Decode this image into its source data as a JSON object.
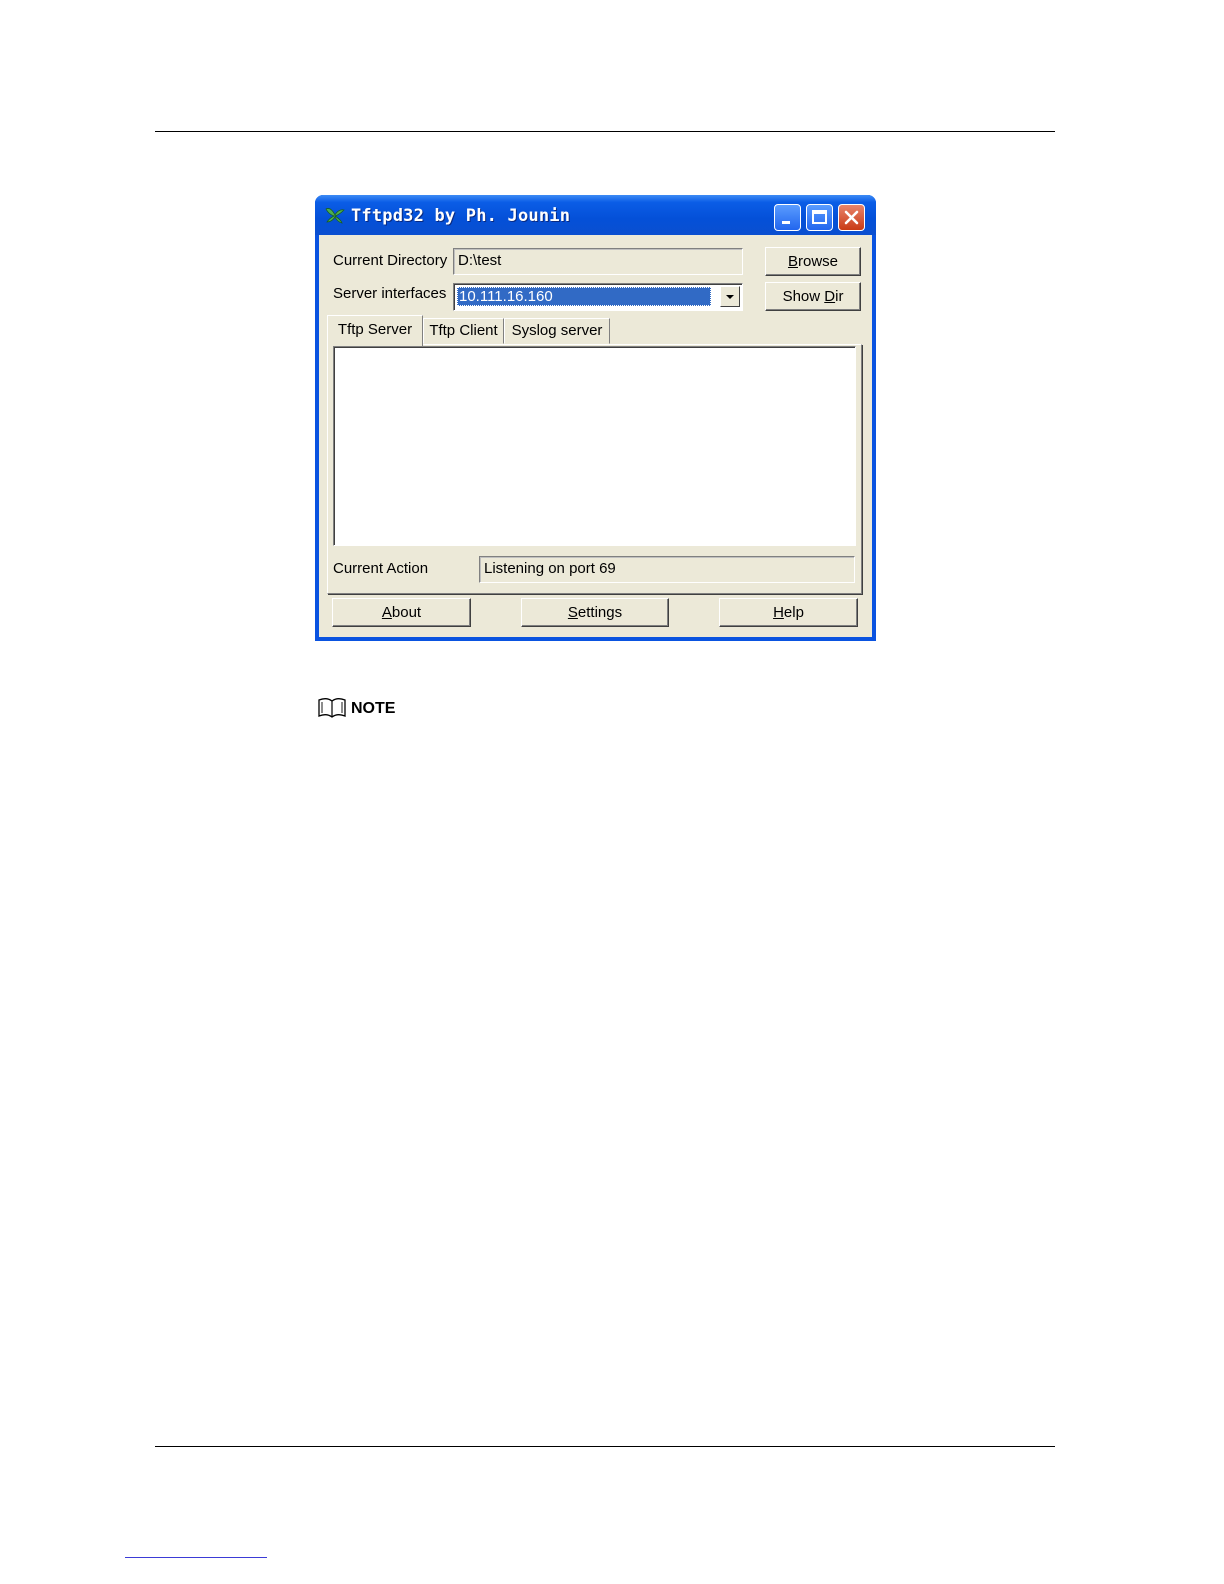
{
  "window": {
    "title": "Tftpd32 by Ph. Jounin",
    "current_directory_label": "Current Directory",
    "current_directory_value": "D:\\test",
    "server_interfaces_label": "Server interfaces",
    "server_interfaces_value": "10.111.16.160",
    "browse_pre": "",
    "browse_key": "B",
    "browse_post": "rowse",
    "showdir_pre": "Show ",
    "showdir_key": "D",
    "showdir_post": "ir",
    "tabs": [
      {
        "label": "Tftp Server"
      },
      {
        "label": "Tftp Client"
      },
      {
        "label": "Syslog server"
      }
    ],
    "current_action_label": "Current Action",
    "current_action_value": "Listening on port 69",
    "about_key": "A",
    "about_post": "bout",
    "settings_key": "S",
    "settings_post": "ettings",
    "help_key": "H",
    "help_post": "elp"
  },
  "note": {
    "label": "NOTE",
    "icon": "book-icon"
  },
  "colors": {
    "titlebar": "#0450d8",
    "window_bg": "#ece9d8",
    "selection": "#316ac5",
    "close_button": "#c93a15"
  }
}
